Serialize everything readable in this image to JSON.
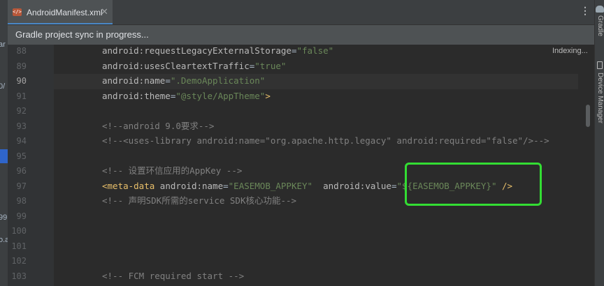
{
  "tab": {
    "title": "AndroidManifest.xml",
    "icon": "xml-file-icon"
  },
  "banner": {
    "text": "Gradle project sync in progress..."
  },
  "status": {
    "indexing": "Indexing..."
  },
  "right_toolbar": {
    "gradle": "Gradle",
    "device_manager": "Device Manager"
  },
  "left_fragments": {
    "a": "ar",
    "b": "0/",
    "c": "99",
    "d": "o.a"
  },
  "editor": {
    "current_line": "90",
    "lines": [
      {
        "num": "88",
        "tokens": [
          [
            "attr",
            "android:requestLegacyExternalStorage"
          ],
          [
            "plain",
            "="
          ],
          [
            "str",
            "\"false\""
          ]
        ]
      },
      {
        "num": "89",
        "tokens": [
          [
            "attr",
            "android:usesCleartextTraffic"
          ],
          [
            "plain",
            "="
          ],
          [
            "str",
            "\"true\""
          ]
        ]
      },
      {
        "num": "90",
        "tokens": [
          [
            "attr",
            "android:name"
          ],
          [
            "plain",
            "="
          ],
          [
            "str",
            "\".DemoApplication\""
          ]
        ]
      },
      {
        "num": "91",
        "tokens": [
          [
            "attr",
            "android:theme"
          ],
          [
            "plain",
            "="
          ],
          [
            "str",
            "\"@style/AppTheme\""
          ],
          [
            "tag",
            ">"
          ]
        ]
      },
      {
        "num": "92",
        "tokens": []
      },
      {
        "num": "93",
        "tokens": [
          [
            "cmt",
            "<!--android 9.0要求-->"
          ]
        ]
      },
      {
        "num": "94",
        "tokens": [
          [
            "cmt",
            "<!--<uses-library android:name=\"org.apache.http.legacy\" android:required=\"false\"/>-->"
          ]
        ]
      },
      {
        "num": "95",
        "tokens": []
      },
      {
        "num": "96",
        "tokens": [
          [
            "cmt",
            "<!-- 设置环信应用的AppKey -->"
          ]
        ]
      },
      {
        "num": "97",
        "tokens": [
          [
            "tag",
            "<meta-data "
          ],
          [
            "attr",
            "android:name"
          ],
          [
            "plain",
            "="
          ],
          [
            "str",
            "\"EASEMOB_APPKEY\""
          ],
          [
            "plain",
            "  "
          ],
          [
            "attr",
            "android:value"
          ],
          [
            "plain",
            "="
          ],
          [
            "str",
            "\"${EASEMOB_APPKEY}\""
          ],
          [
            "plain",
            " "
          ],
          [
            "tag",
            "/>"
          ]
        ]
      },
      {
        "num": "98",
        "tokens": [
          [
            "cmt",
            "<!-- 声明SDK所需的service SDK核心功能-->"
          ]
        ]
      },
      {
        "num": "99",
        "tokens": []
      },
      {
        "num": "100",
        "tokens": []
      },
      {
        "num": "101",
        "tokens": []
      },
      {
        "num": "102",
        "tokens": []
      },
      {
        "num": "103",
        "tokens": [
          [
            "cmt",
            "<!-- FCM required start -->"
          ]
        ]
      }
    ]
  },
  "colors": {
    "highlight_box": "#33dd33",
    "comment": "#808080",
    "string": "#6a8759",
    "tag": "#e8bf6a"
  }
}
